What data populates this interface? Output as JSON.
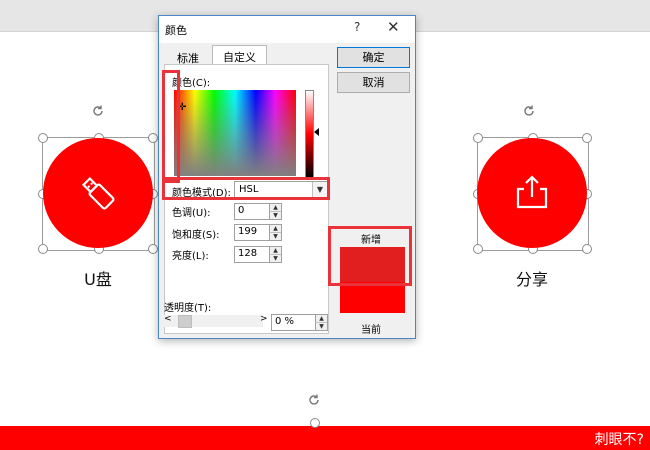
{
  "slide": {
    "left_caption": "U盘",
    "right_caption": "分享",
    "bottom_bar_text": "刺眼不?"
  },
  "dialog": {
    "title": "颜色",
    "help_label": "?",
    "close_label": "✕",
    "tabs": [
      {
        "label": "标准",
        "active": false
      },
      {
        "label": "自定义",
        "active": true
      }
    ],
    "ok_label": "确定",
    "cancel_label": "取消",
    "colors_label": "颜色(C):",
    "color_model_label": "颜色模式(D):",
    "color_model_value": "HSL",
    "fields": [
      {
        "label": "色调(U):",
        "value": "0"
      },
      {
        "label": "饱和度(S):",
        "value": "199"
      },
      {
        "label": "亮度(L):",
        "value": "128"
      }
    ],
    "new_label": "新增",
    "current_label": "当前",
    "transparency_label": "透明度(T):",
    "transparency_value": "0 %",
    "slider_left": "<",
    "slider_right": ">"
  },
  "colors": {
    "accent_red": "#fe0000",
    "new_color": "#e21f1f",
    "current_color": "#ff0000",
    "highlight": "#e9323a"
  },
  "icons": [
    "usb-drive-icon",
    "share-icon",
    "rotate-icon",
    "chevron-down-icon"
  ]
}
